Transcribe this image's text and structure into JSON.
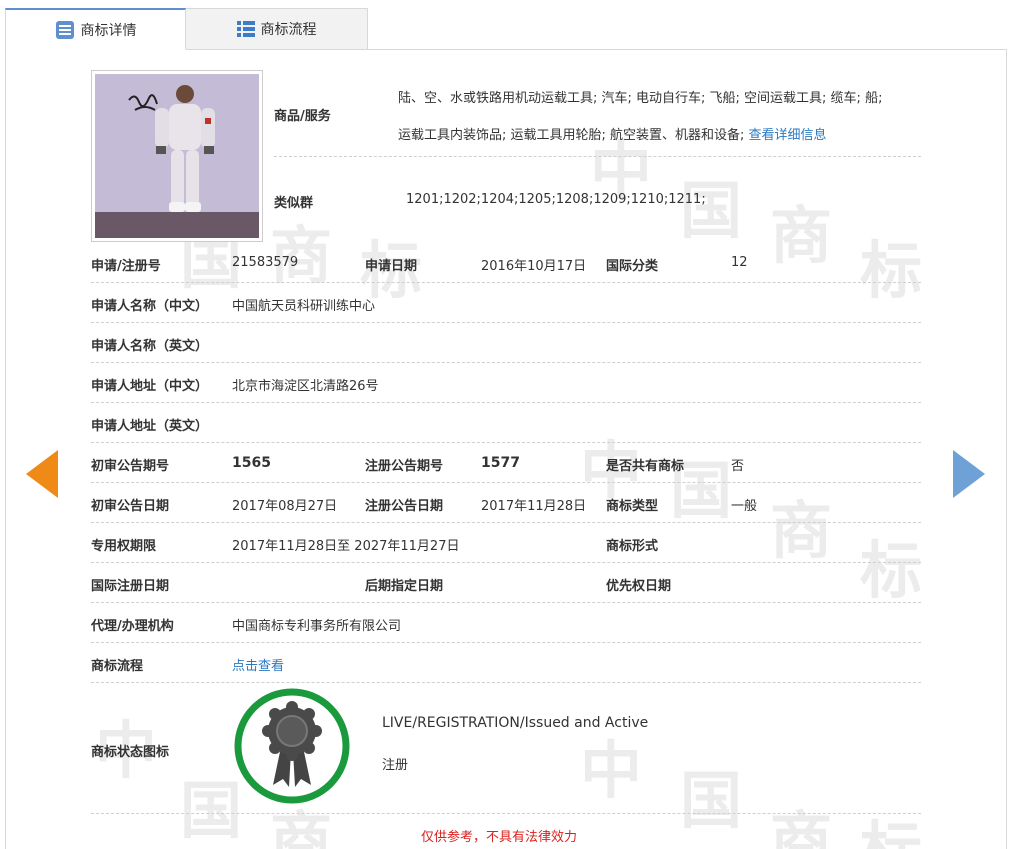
{
  "tabs": [
    {
      "label": "商标详情",
      "icon": "list-detail-icon"
    },
    {
      "label": "商标流程",
      "icon": "flow-list-icon"
    }
  ],
  "goods": {
    "label": "商品/服务",
    "line1": "陆、空、水或铁路用机动运载工具; 汽车; 电动自行车; 飞船; 空间运载工具; 缆车; 船;",
    "line2": "运载工具内装饰品; 运载工具用轮胎; 航空装置、机器和设备;",
    "detail_link": "查看详细信息"
  },
  "similar_group": {
    "label": "类似群",
    "value": "1201;1202;1204;1205;1208;1209;1210;1211;"
  },
  "fields": {
    "reg_no_label": "申请/注册号",
    "reg_no": "21583579",
    "apply_date_label": "申请日期",
    "apply_date": "2016年10月17日",
    "intl_class_label": "国际分类",
    "intl_class": "12",
    "applicant_cn_label": "申请人名称（中文）",
    "applicant_cn": "中国航天员科研训练中心",
    "applicant_en_label": "申请人名称（英文）",
    "applicant_en": "",
    "address_cn_label": "申请人地址（中文）",
    "address_cn": "北京市海淀区北清路26号",
    "address_en_label": "申请人地址（英文）",
    "address_en": "",
    "prelim_issue_label": "初审公告期号",
    "prelim_issue": "1565",
    "reg_issue_label": "注册公告期号",
    "reg_issue": "1577",
    "shared_label": "是否共有商标",
    "shared": "否",
    "prelim_date_label": "初审公告日期",
    "prelim_date": "2017年08月27日",
    "reg_date_label": "注册公告日期",
    "reg_date": "2017年11月28日",
    "tm_type_label": "商标类型",
    "tm_type": "一般",
    "term_label": "专用权期限",
    "term": "2017年11月28日至 2027年11月27日",
    "tm_form_label": "商标形式",
    "tm_form": "",
    "intl_reg_date_label": "国际注册日期",
    "later_designation_label": "后期指定日期",
    "priority_date_label": "优先权日期",
    "agent_label": "代理/办理机构",
    "agent": "中国商标专利事务所有限公司",
    "process_label": "商标流程",
    "process_link": "点击查看"
  },
  "status": {
    "label": "商标状态图标",
    "english": "LIVE/REGISTRATION/Issued and Active",
    "chinese": "注册",
    "ring_color": "#1a9a3c"
  },
  "disclaimer": "仅供参考，不具有法律效力",
  "colors": {
    "accent": "#5f8fcf",
    "link": "#2b79c2",
    "prev_arrow": "#f08a16",
    "next_arrow": "#6ea2d6",
    "disclaimer": "#d9211e"
  }
}
